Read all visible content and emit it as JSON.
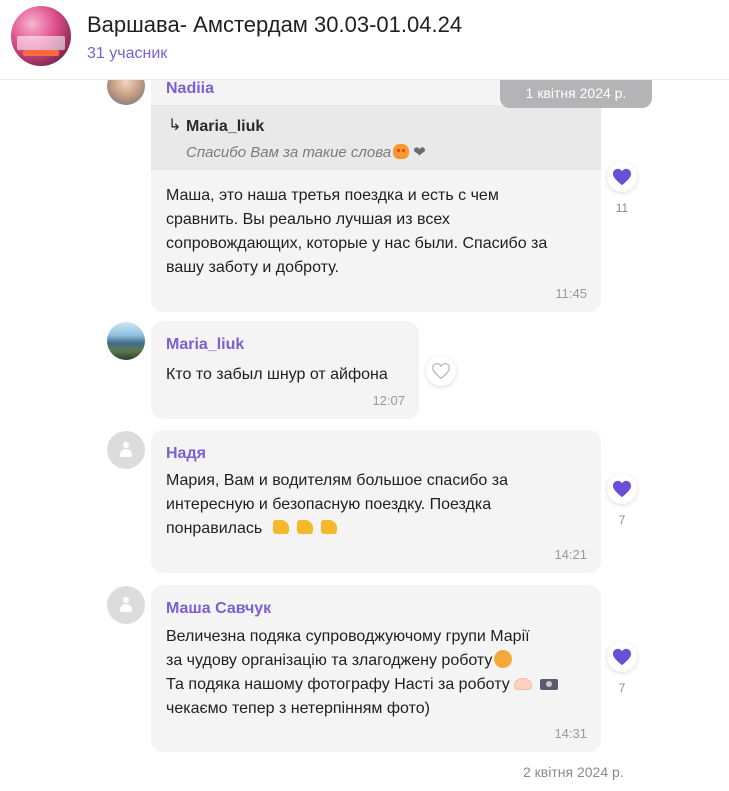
{
  "header": {
    "title": "Варшава- Амстердам 30.03-01.04.24",
    "members": "31 учасник"
  },
  "dates": {
    "top": "1 квітня 2024 р.",
    "bottom": "2 квітня 2024 р."
  },
  "colors": {
    "accent": "#7a61cf",
    "bubble": "#f4f4f5",
    "heart": "#6c4fd8"
  },
  "messages": [
    {
      "author": "Nadiia",
      "reply": {
        "author": "Maria_liuk",
        "text": "Спасибо Вам за такие слова"
      },
      "lines": [
        "Маша, это наша третья поездка и есть с чем",
        "сравнить. Вы реально лучшая из всех",
        "сопровождающих, которые у нас были. Спасибо за",
        "вашу заботу и доброту."
      ],
      "time": "11:45",
      "reaction": {
        "icon": "filled-heart-icon",
        "count": "11"
      }
    },
    {
      "author": "Maria_liuk",
      "lines": [
        "Кто то забыл шнур от айфона"
      ],
      "time": "12:07",
      "reaction": {
        "icon": "outline-heart-icon",
        "count": ""
      }
    },
    {
      "author": "Надя",
      "lines": [
        "Мария, Вам и водителям большое спасибо за",
        "интересную и безопасную поездку. Поездка",
        "понравилась"
      ],
      "time": "14:21",
      "reaction": {
        "icon": "filled-heart-icon",
        "count": "7"
      }
    },
    {
      "author": "Маша Савчук",
      "lines": [
        "Величезна подяка супроводжуючому групи Марії",
        "за чудову організацію та злагоджену роботу",
        "Та подяка нашому фотографу Насті  за роботу",
        "чекаємо тепер з нетерпінням фото)"
      ],
      "time": "14:31",
      "reaction": {
        "icon": "filled-heart-icon",
        "count": "7"
      }
    }
  ]
}
